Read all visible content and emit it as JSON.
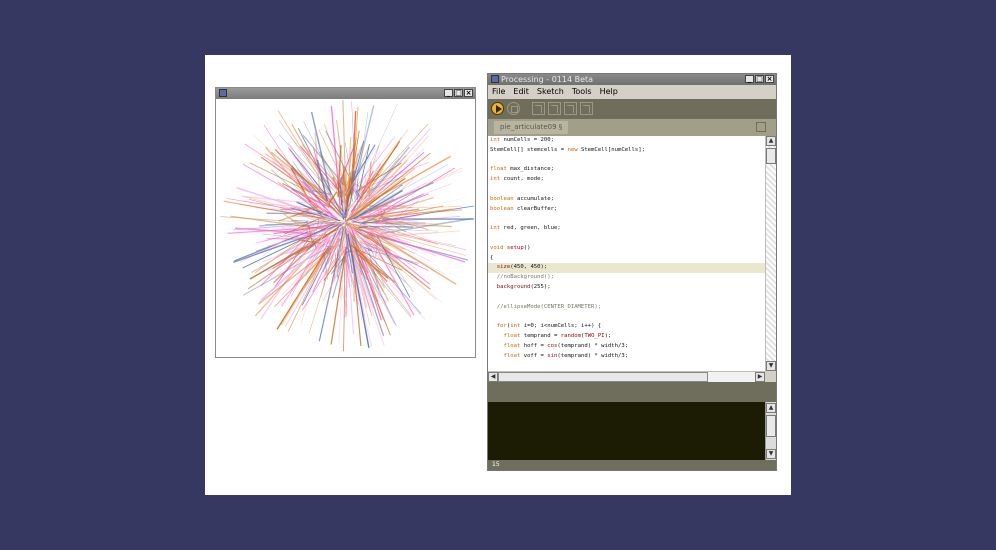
{
  "sketch_window": {
    "title": "",
    "buttons": [
      "_",
      "□",
      "×"
    ],
    "canvas_colors": [
      "#c86a1a",
      "#ff4fd0",
      "#4a6fae",
      "#f2a060",
      "#f7b3ea"
    ]
  },
  "ide": {
    "title": "Processing - 0114 Beta",
    "window_buttons": [
      "_",
      "□",
      "×"
    ],
    "menu": [
      "File",
      "Edit",
      "Sketch",
      "Tools",
      "Help"
    ],
    "tab": "pie_articulate09 §",
    "line_number": "15",
    "code": [
      "int numCells = 200;",
      "StemCell[] stemcells = new StemCell[numCells];",
      "",
      "float max_distance;",
      "int count, mode;",
      "",
      "boolean accumulate;",
      "boolean clearBuffer;",
      "",
      "int red, green, blue;",
      "",
      "void setup()",
      "{",
      "  size(450, 450);",
      "  //noBackground();",
      "  background(255);",
      "",
      "  //ellipseMode(CENTER_DIAMETER);",
      "",
      "  for(int i=0; i<numCells; i++) {",
      "    float temprand = random(TWO_PI);",
      "    float hoff = cos(temprand) * width/3;",
      "    float voff = sin(temprand) * width/3;"
    ],
    "highlight_line": 13,
    "colors": {
      "toolbar": "#6f6e5c",
      "run": "#f1b221",
      "console": "#1c1b04",
      "highlight": "#e9e7cd"
    }
  }
}
